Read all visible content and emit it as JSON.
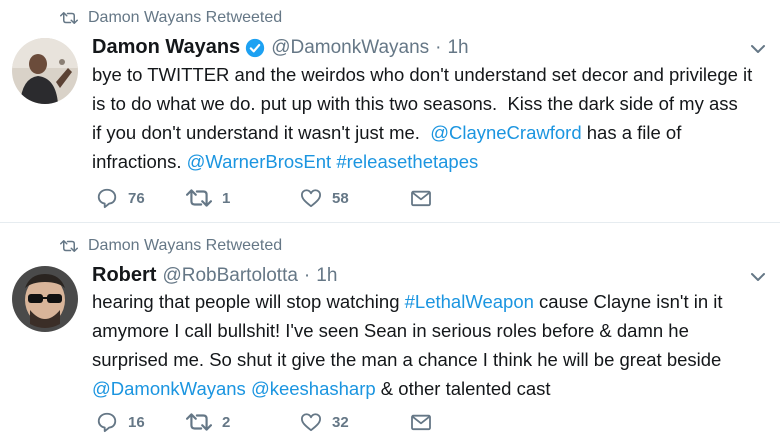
{
  "tweets": [
    {
      "retweeted_by": "Damon Wayans Retweeted",
      "name": "Damon Wayans",
      "verified": true,
      "handle": "@DamonkWayans",
      "dot": "·",
      "time": "1h",
      "lines": [
        [
          {
            "t": "bye to TWITTER and the weirdos who don't understand set decor and privilege it"
          }
        ],
        [
          {
            "t": "is to do what we do. put up with this two seasons.  Kiss the dark side of my ass"
          }
        ],
        [
          {
            "t": "if you don't understand it wasn't just me.  "
          },
          {
            "t": "@ClayneCrawford",
            "link": true
          },
          {
            "t": " has a file of"
          }
        ],
        [
          {
            "t": "infractions. "
          },
          {
            "t": "@WarnerBrosEnt",
            "link": true
          },
          {
            "t": " "
          },
          {
            "t": "#releasethetapes",
            "link": true
          }
        ]
      ],
      "replies": "76",
      "retweets": "1",
      "likes": "58"
    },
    {
      "retweeted_by": "Damon Wayans Retweeted",
      "name": "Robert",
      "verified": false,
      "handle": "@RobBartolotta",
      "dot": "·",
      "time": "1h",
      "lines": [
        [
          {
            "t": "hearing that people will stop watching "
          },
          {
            "t": "#LethalWeapon",
            "link": true
          },
          {
            "t": " cause Clayne isn't in it"
          }
        ],
        [
          {
            "t": "amymore I call bullshit! I've seen Sean in serious roles before & damn he"
          }
        ],
        [
          {
            "t": "surprised me. So shut it give the man a chance I think he will be great beside"
          }
        ],
        [
          {
            "t": "@DamonkWayans",
            "link": true
          },
          {
            "t": " "
          },
          {
            "t": "@keeshasharp",
            "link": true
          },
          {
            "t": " & other talented cast"
          }
        ]
      ],
      "replies": "16",
      "retweets": "2",
      "likes": "32"
    }
  ]
}
